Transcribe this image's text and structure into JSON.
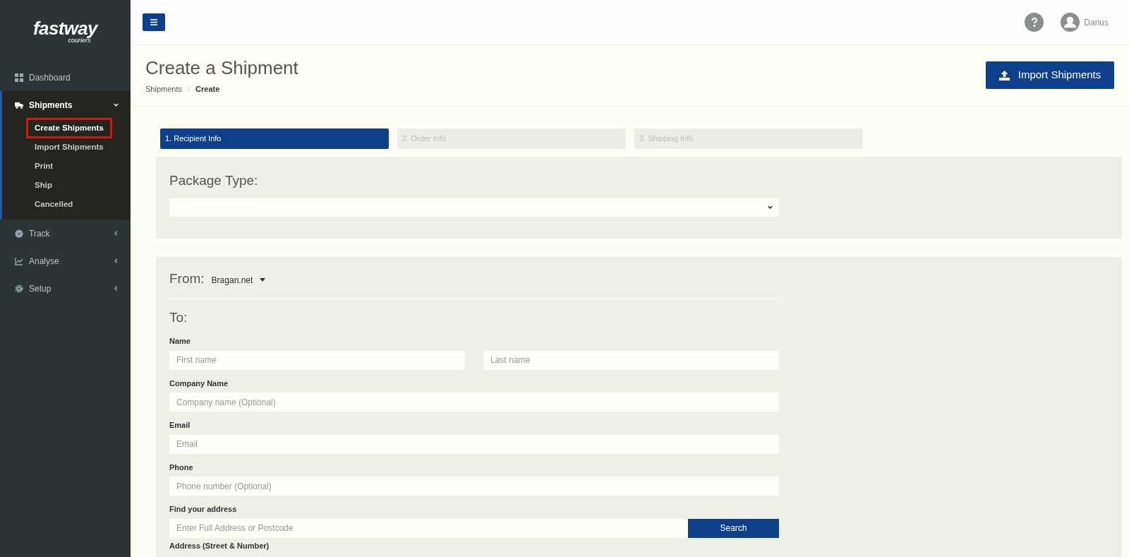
{
  "sidebar": {
    "logo": {
      "name": "fastway",
      "tagline": "couriers"
    },
    "items": [
      {
        "label": "Dashboard",
        "kind": "link"
      },
      {
        "label": "Shipments",
        "kind": "group",
        "expanded": true,
        "children": [
          {
            "label": "Create Shipments",
            "selected": true
          },
          {
            "label": "Import Shipments",
            "selected": false
          },
          {
            "label": "Print",
            "selected": false
          },
          {
            "label": "Ship",
            "selected": false
          },
          {
            "label": "Cancelled",
            "selected": false
          }
        ]
      },
      {
        "label": "Track",
        "kind": "group",
        "expanded": false
      },
      {
        "label": "Analyse",
        "kind": "group",
        "expanded": false
      },
      {
        "label": "Setup",
        "kind": "group",
        "expanded": false
      }
    ]
  },
  "topbar": {
    "user": "Darius"
  },
  "page": {
    "title": "Create a Shipment",
    "breadcrumb_separator": "/",
    "breadcrumb": [
      {
        "label": "Shipments",
        "current": false
      },
      {
        "label": "Create",
        "current": true
      }
    ],
    "import_button": "Import Shipments"
  },
  "steps": [
    {
      "label": "1. Recipient Info",
      "selected": true
    },
    {
      "label": "2. Order Info",
      "selected": false
    },
    {
      "label": "3. Shipping Info",
      "selected": false
    }
  ],
  "package": {
    "label": "Package Type:"
  },
  "from": {
    "label": "From:",
    "value": "Bragan.net"
  },
  "to": {
    "label": "To:",
    "fields": [
      {
        "label": "Name",
        "placeholders": [
          "First name",
          "Last name"
        ]
      },
      {
        "label": "Company Name",
        "placeholders": [
          "Company name (Optional)"
        ]
      },
      {
        "label": "Email",
        "placeholders": [
          "Email"
        ]
      },
      {
        "label": "Phone",
        "placeholders": [
          "Phone number (Optional)"
        ]
      },
      {
        "label": "Find your address",
        "placeholders": [
          "Enter Full Address or Postcode"
        ],
        "button": "Search"
      }
    ],
    "next_label": "Address (Street & Number)"
  }
}
